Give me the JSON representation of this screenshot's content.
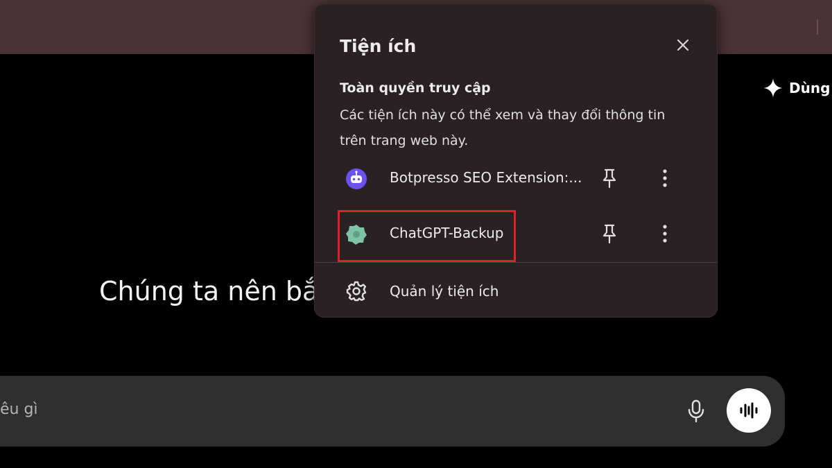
{
  "page": {
    "upgrade_label": "Dùng",
    "headline": "Chúng ta nên bắ",
    "composer_placeholder": "êu gì"
  },
  "extensions_popup": {
    "title": "Tiện ích",
    "section_heading": "Toàn quyền truy cập",
    "section_description": "Các tiện ích này có thể xem và thay đổi thông tin trên trang web này.",
    "items": [
      {
        "name": "Botpresso SEO Extension:...",
        "icon": "botpresso-robot-icon",
        "icon_color": "#6b52f0"
      },
      {
        "name": "ChatGPT-Backup",
        "icon": "chatgpt-backup-icon",
        "icon_color": "#7ec3a8",
        "highlighted": true
      }
    ],
    "manage_label": "Quản lý tiện ích"
  },
  "colors": {
    "toolbar_bg": "#4a3236",
    "popup_bg": "#292123",
    "highlight": "#e1202a",
    "page_bg": "#000000",
    "composer_bg": "#2f2f2f"
  }
}
